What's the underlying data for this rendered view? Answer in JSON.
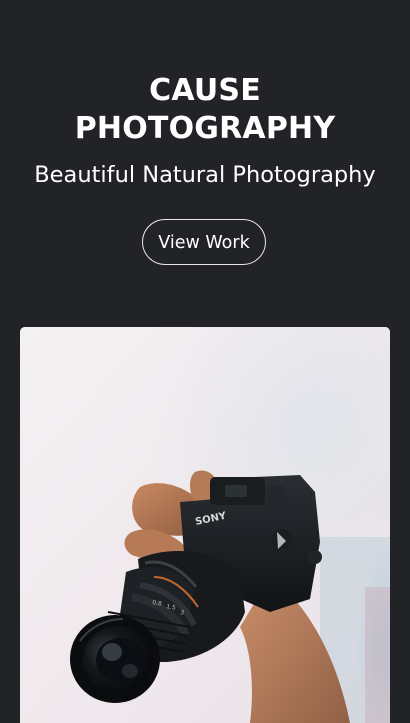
{
  "hero": {
    "title_line1": "CAUSE",
    "title_line2": "PHOTOGRAPHY",
    "subtitle": "Beautiful Natural Photography",
    "cta_label": "View Work"
  },
  "photo": {
    "subject": "hand holding camera",
    "camera_brand_text": "SONY"
  },
  "colors": {
    "background": "#212327",
    "text": "#ffffff",
    "button_border": "#e6e6e6",
    "photo_backdrop": "#f1eef0"
  }
}
